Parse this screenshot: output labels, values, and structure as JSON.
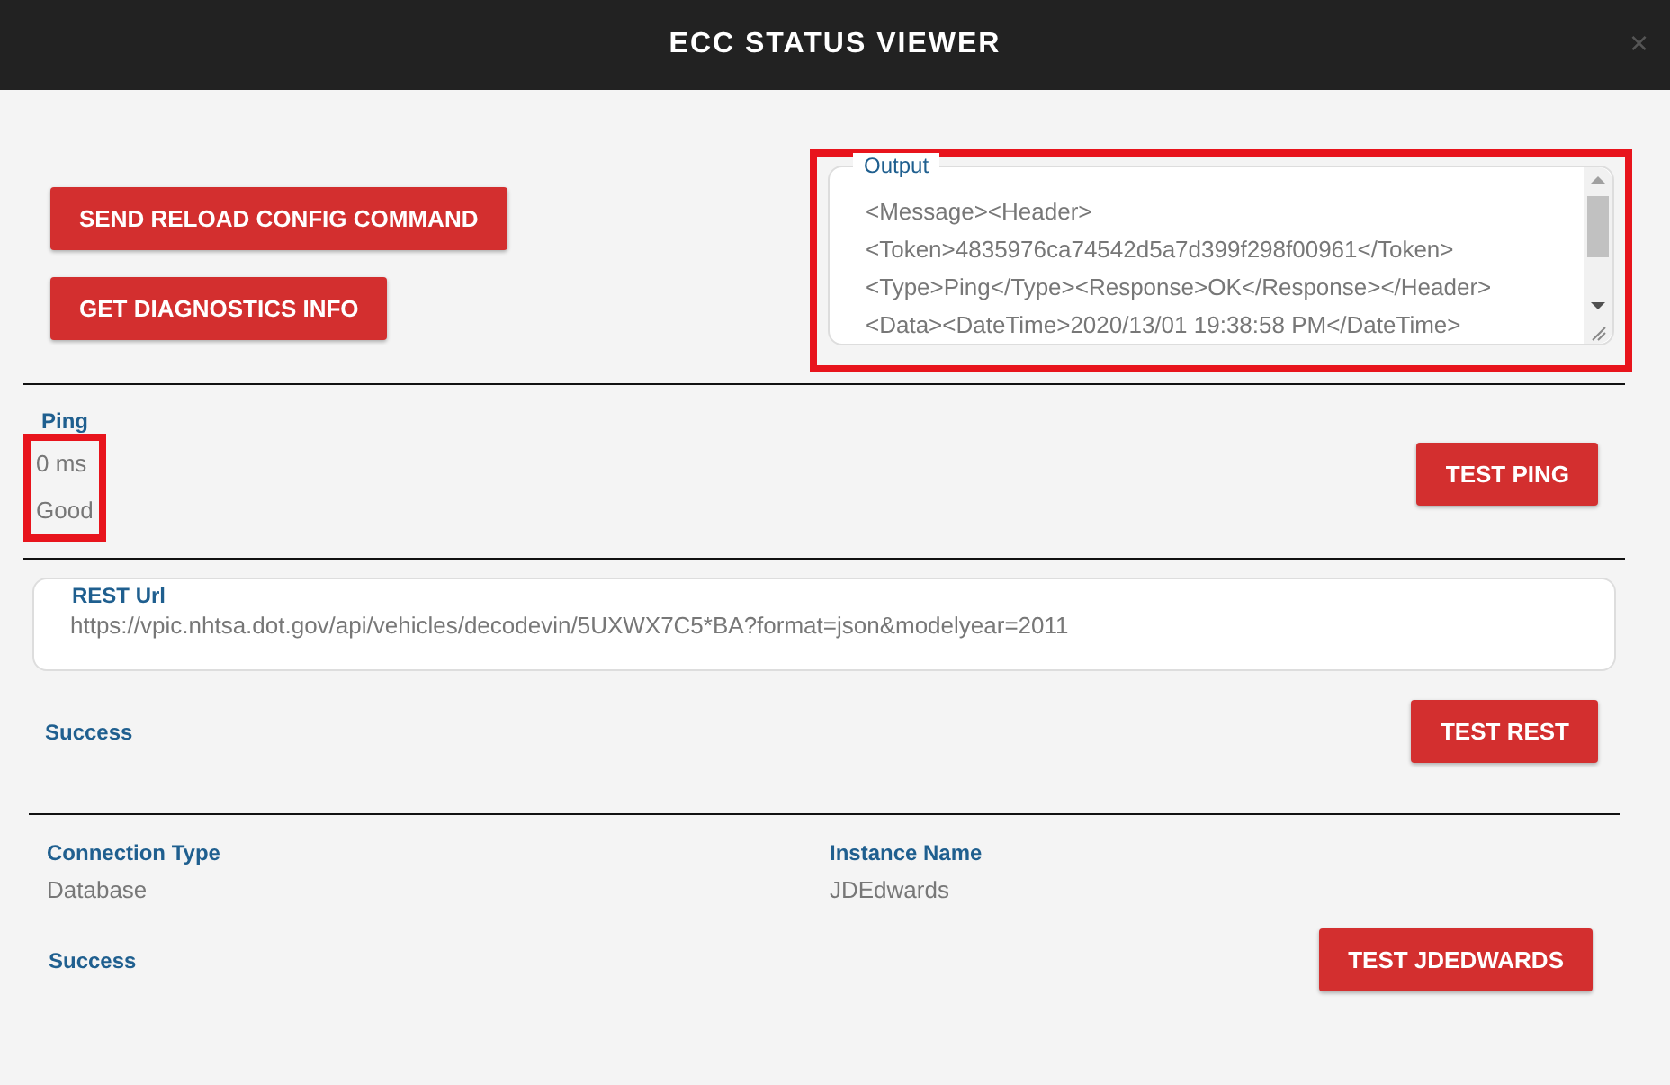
{
  "window": {
    "title": "ECC STATUS VIEWER",
    "close": "×"
  },
  "actions": [
    "SEND RELOAD CONFIG COMMAND",
    "GET DIAGNOSTICS INFO"
  ],
  "output": {
    "label": "Output",
    "lines": [
      "<Message><Header>",
      "<Token>4835976ca74542d5a7d399f298f00961</Token>",
      "<Type>Ping</Type><Response>OK</Response></Header>",
      "<Data><DateTime>2020/13/01 19:38:58 PM</DateTime>"
    ],
    "highlighted": true
  },
  "ping": {
    "label": "Ping",
    "value": "0 ms",
    "status": "Good",
    "highlighted": true,
    "button": "TEST PING"
  },
  "rest": {
    "label": "REST Url",
    "value": "https://vpic.nhtsa.dot.gov/api/vehicles/decodevin/5UXWX7C5*BA?format=json&modelyear=2011",
    "status": "Success",
    "button": "TEST REST"
  },
  "connection": {
    "fields": [
      {
        "label": "Connection Type",
        "value": "Database"
      },
      {
        "label": "Instance Name",
        "value": "JDEdwards"
      }
    ],
    "status": "Success",
    "button": "TEST JDEDWARDS"
  }
}
